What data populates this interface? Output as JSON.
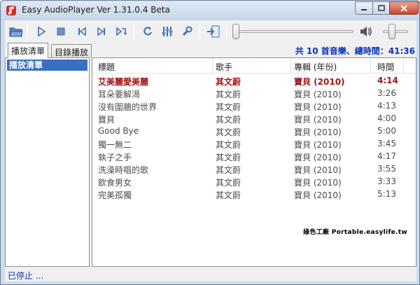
{
  "window": {
    "title": "Easy AudioPlayer Ver 1.31.0.4 Beta"
  },
  "toolbar": {
    "buttons": [
      {
        "name": "open-folder-button",
        "icon": "folder-open-icon"
      },
      {
        "name": "play-button",
        "icon": "play-icon"
      },
      {
        "name": "stop-button",
        "icon": "stop-icon"
      },
      {
        "name": "previous-button",
        "icon": "skip-previous-icon"
      },
      {
        "name": "next-button",
        "icon": "skip-next-icon"
      },
      {
        "name": "random-button",
        "icon": "shuffle-icon"
      },
      {
        "name": "repeat-button",
        "icon": "repeat-icon"
      },
      {
        "name": "equalizer-button",
        "icon": "equalizer-icon"
      },
      {
        "name": "settings-button",
        "icon": "wrench-icon"
      },
      {
        "name": "exit-button",
        "icon": "exit-icon"
      }
    ],
    "volume_icon": "speaker-icon"
  },
  "tabs": [
    {
      "label": "播放清單",
      "active": true
    },
    {
      "label": "目錄播放",
      "active": false
    }
  ],
  "summary": "共 10 首音樂、總時間：41:36",
  "playlists": [
    "播放清單"
  ],
  "columns": [
    "標題",
    "歌手",
    "專輯 (年份)",
    "時間"
  ],
  "tracks": [
    {
      "title": "艾美麗愛美麗",
      "artist": "其文蔚",
      "album": "寶貝 (2010)",
      "time": "4:14",
      "playing": true
    },
    {
      "title": "耳朵要解渴",
      "artist": "其文蔚",
      "album": "寶貝 (2010)",
      "time": "3:26"
    },
    {
      "title": "沒有圍牆的世界",
      "artist": "其文蔚",
      "album": "寶貝 (2010)",
      "time": "4:13"
    },
    {
      "title": "寶貝",
      "artist": "其文蔚",
      "album": "寶貝 (2010)",
      "time": "4:00"
    },
    {
      "title": "Good Bye",
      "artist": "其文蔚",
      "album": "寶貝 (2010)",
      "time": "5:00"
    },
    {
      "title": "獨一無二",
      "artist": "其文蔚",
      "album": "寶貝 (2010)",
      "time": "3:45"
    },
    {
      "title": "執子之手",
      "artist": "其文蔚",
      "album": "寶貝 (2010)",
      "time": "4:17"
    },
    {
      "title": "洗澡時唱的歌",
      "artist": "其文蔚",
      "album": "寶貝 (2010)",
      "time": "3:55"
    },
    {
      "title": "飲食男女",
      "artist": "其文蔚",
      "album": "寶貝 (2010)",
      "time": "3:33"
    },
    {
      "title": "完美孤獨",
      "artist": "其文蔚",
      "album": "寶貝 (2010)",
      "time": "5:13"
    }
  ],
  "watermark": "綠色工廠 Portable.easylife.tw",
  "status": "已停止 ...",
  "colors": {
    "accent_blue": "#0b32b8",
    "selection": "#3a6fc4",
    "playing_red": "#a31414"
  }
}
